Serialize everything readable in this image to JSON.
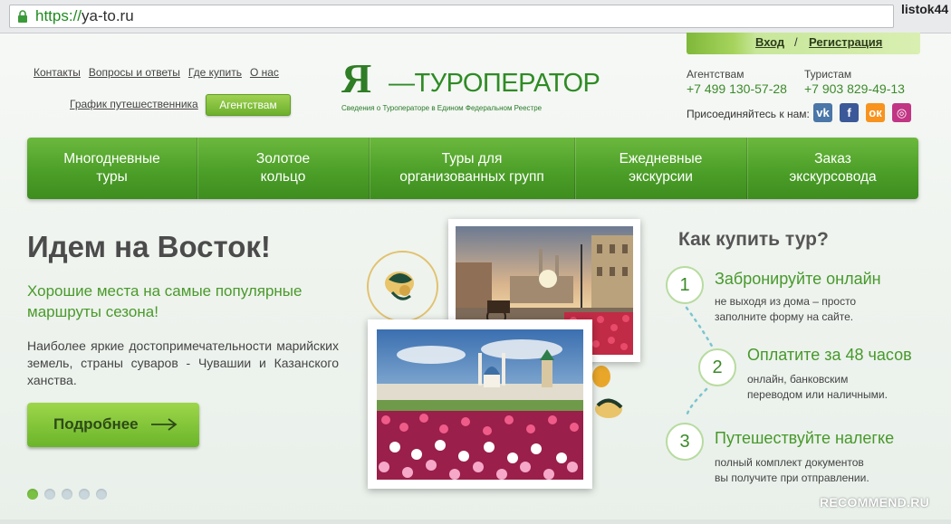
{
  "browser": {
    "url_scheme": "https://",
    "url_host": "ya-to.ru",
    "user": "listok44",
    "lock_icon": "lock-icon"
  },
  "header": {
    "top_links": [
      "Контакты",
      "Вопросы и ответы",
      "Где купить",
      "О нас"
    ],
    "traveler_schedule": "График путешественника",
    "agencies_button": "Агентствам",
    "logo_mark": "Я",
    "logo_text": "—ТУРОПЕРАТОР",
    "logo_sub": "Сведения о Туроператоре в Едином Федеральном Реестре",
    "login": "Вход",
    "login_sep": "/",
    "register": "Регистрация",
    "agencies_label": "Агентствам",
    "agencies_phone": "+7 499 130-57-28",
    "tourists_label": "Туристам",
    "tourists_phone": "+7 903 829-49-13",
    "join_label": "Присоединяйтесь к нам:",
    "social": [
      {
        "name": "vk-icon",
        "glyph": "vk",
        "color": "#4a76a8"
      },
      {
        "name": "facebook-icon",
        "glyph": "f",
        "color": "#3b5998"
      },
      {
        "name": "odnoklassniki-icon",
        "glyph": "ок",
        "color": "#f7931e"
      },
      {
        "name": "instagram-icon",
        "glyph": "◎",
        "color": "#c13584"
      }
    ]
  },
  "nav": {
    "items": [
      "Многодневные\nтуры",
      "Золотое\nкольцо",
      "Туры для\nорганизованных групп",
      "Ежедневные\nэкскурсии",
      "Заказ\nэкскурсовода"
    ]
  },
  "hero": {
    "title": "Идем на Восток!",
    "subtitle": "Хорошие места на самые популярные маршруты сезона!",
    "description": "Наиболее яркие достопримечательности марийских земель, страны суваров - Чувашии и Казанского ханства.",
    "more_button": "Подробнее",
    "slides_total": 5,
    "slide_active": 1
  },
  "how_to_buy": {
    "title": "Как купить тур?",
    "steps": [
      {
        "num": "1",
        "title": "Забронируйте онлайн",
        "text": "не выходя из дома – просто\nзаполните форму на сайте."
      },
      {
        "num": "2",
        "title": "Оплатите за 48 часов",
        "text": "онлайн, банковским\nпереводом или наличными."
      },
      {
        "num": "3",
        "title": "Путешествуйте налегке",
        "text": "полный комплект документов\nвы получите при отправлении."
      }
    ]
  },
  "watermark": "RECOMMEND.RU",
  "colors": {
    "brand_green": "#4c9f28",
    "accent_green": "#7ac143",
    "text_gray": "#444444"
  }
}
